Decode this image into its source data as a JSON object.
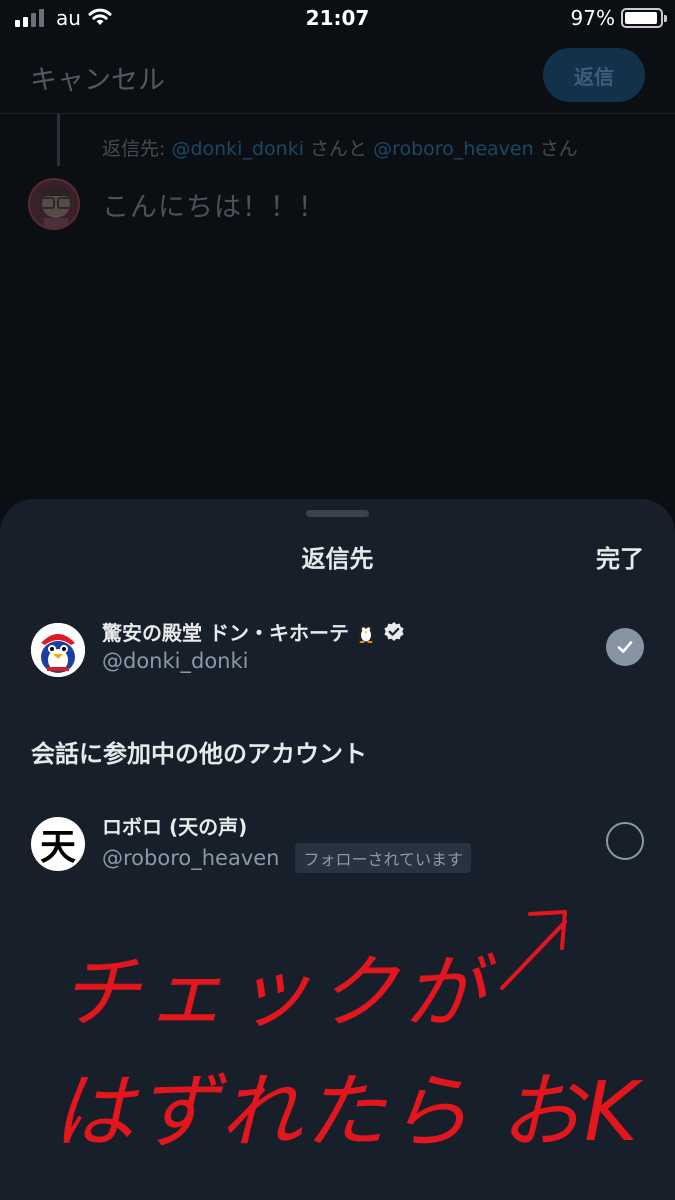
{
  "status_bar": {
    "carrier": "au",
    "time": "21:07",
    "battery": "97%",
    "battery_level": 0.97,
    "signal_bars": 2
  },
  "compose": {
    "cancel_label": "キャンセル",
    "reply_button_label": "返信",
    "reply_to_prefix": "返信先: ",
    "reply_to_user1": "@donki_donki",
    "reply_to_join": " さんと ",
    "reply_to_user2": "@roboro_heaven",
    "reply_to_suffix": " さん",
    "tweet_text": "こんにちは！！！"
  },
  "sheet": {
    "title": "返信先",
    "done_label": "完了",
    "primary_account": {
      "name": "驚安の殿堂 ドン・キホーテ",
      "handle": "@donki_donki",
      "verified": true,
      "selected": true,
      "icon": "penguin-emoji"
    },
    "section_title": "会話に参加中の他のアカウント",
    "other_accounts": [
      {
        "name": "ロボロ (天の声)",
        "handle": "@roboro_heaven",
        "badge": "フォローされています",
        "avatar_char": "天",
        "selected": false
      }
    ]
  },
  "annotation": {
    "line1": "チェックが",
    "line2": "はずれたら おK",
    "color": "#e3161e"
  },
  "colors": {
    "accent": "#1d9bf0",
    "sheet_bg": "#17202a",
    "background": "#0b0e12",
    "checkbox_on": "#8795a3"
  }
}
